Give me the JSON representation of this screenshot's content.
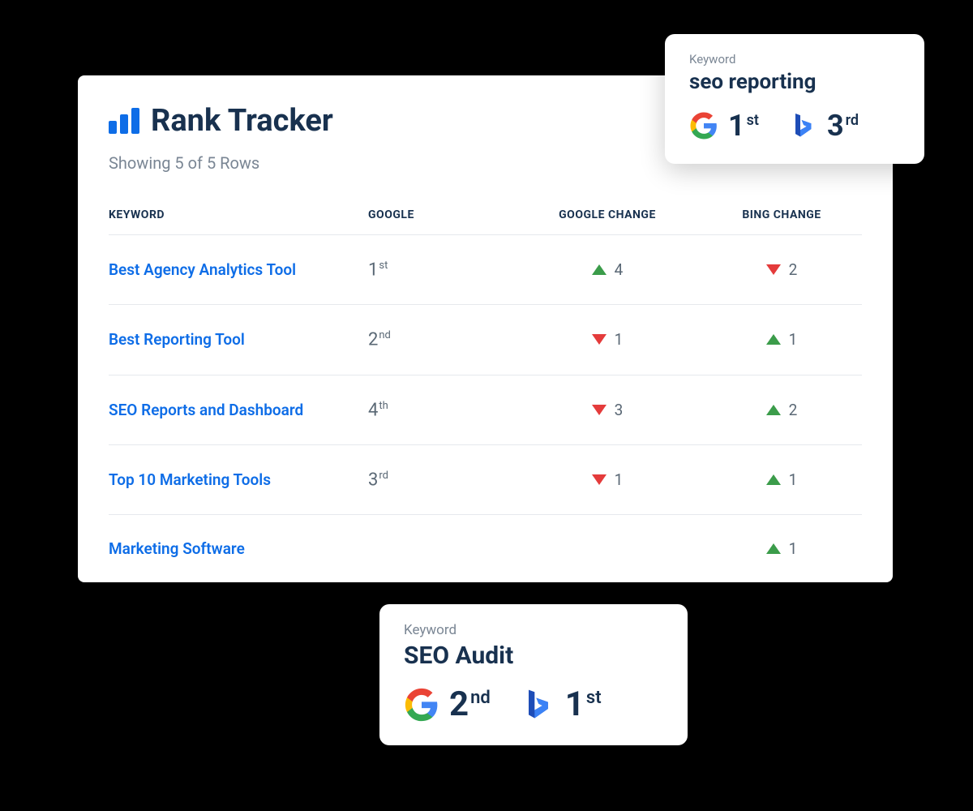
{
  "header": {
    "title": "Rank Tracker",
    "subtitle": "Showing 5 of 5 Rows"
  },
  "columns": {
    "keyword": "KEYWORD",
    "google": "GOOGLE",
    "google_change": "GOOGLE CHANGE",
    "bing_change": "BING CHANGE"
  },
  "rows": [
    {
      "keyword": "Best Agency Analytics Tool",
      "rank_num": "1",
      "rank_suffix": "st",
      "google_change_dir": "up",
      "google_change_val": "4",
      "bing_change_dir": "down",
      "bing_change_val": "2"
    },
    {
      "keyword": "Best Reporting Tool",
      "rank_num": "2",
      "rank_suffix": "nd",
      "google_change_dir": "down",
      "google_change_val": "1",
      "bing_change_dir": "up",
      "bing_change_val": "1"
    },
    {
      "keyword": "SEO Reports and Dashboard",
      "rank_num": "4",
      "rank_suffix": "th",
      "google_change_dir": "down",
      "google_change_val": "3",
      "bing_change_dir": "up",
      "bing_change_val": "2"
    },
    {
      "keyword": "Top 10 Marketing Tools",
      "rank_num": "3",
      "rank_suffix": "rd",
      "google_change_dir": "down",
      "google_change_val": "1",
      "bing_change_dir": "up",
      "bing_change_val": "1"
    },
    {
      "keyword": "Marketing Software",
      "rank_num": "",
      "rank_suffix": "",
      "google_change_dir": "",
      "google_change_val": "",
      "bing_change_dir": "up",
      "bing_change_val": "1"
    }
  ],
  "popup_top": {
    "label": "Keyword",
    "keyword": "seo reporting",
    "google_rank": "1",
    "google_suffix": "st",
    "bing_rank": "3",
    "bing_suffix": "rd"
  },
  "popup_bottom": {
    "label": "Keyword",
    "keyword": "SEO Audit",
    "google_rank": "2",
    "google_suffix": "nd",
    "bing_rank": "1",
    "bing_suffix": "st"
  }
}
